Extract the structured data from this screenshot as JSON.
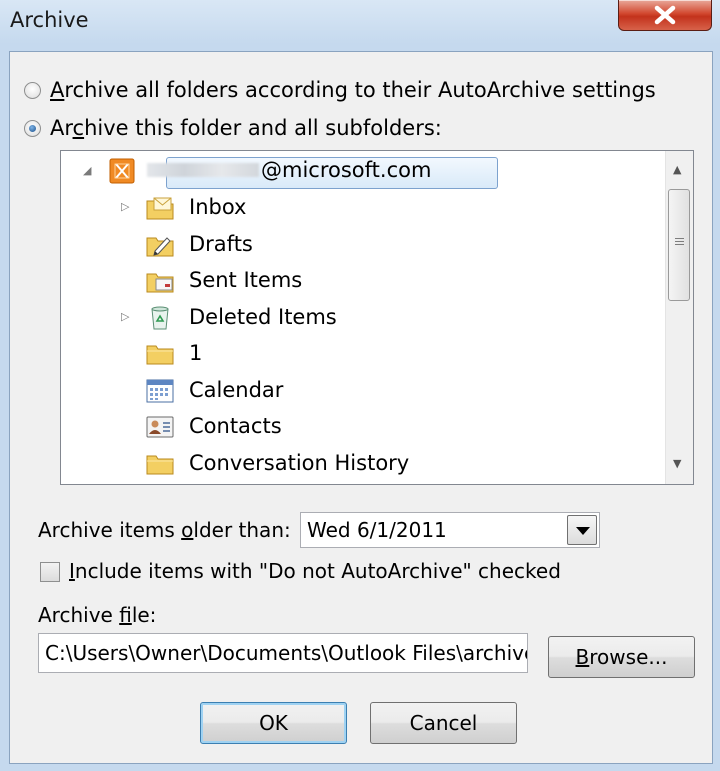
{
  "window": {
    "title": "Archive"
  },
  "options": {
    "archive_all_label": "Archive all folders according to their AutoArchive settings",
    "archive_all_mnemonic": "A",
    "archive_this_label_pre": "Ar",
    "archive_this_mnemonic": "c",
    "archive_this_label_post": "hive this folder and all subfolders:"
  },
  "tree": {
    "account_domain": "@microsoft.com",
    "folders": [
      {
        "label": "Inbox",
        "icon": "inbox-folder-icon",
        "expandable": true
      },
      {
        "label": "Drafts",
        "icon": "drafts-folder-icon",
        "expandable": false
      },
      {
        "label": "Sent Items",
        "icon": "sent-items-folder-icon",
        "expandable": false
      },
      {
        "label": "Deleted Items",
        "icon": "recycle-bin-icon",
        "expandable": true
      },
      {
        "label": "1",
        "icon": "folder-icon",
        "expandable": false
      },
      {
        "label": "Calendar",
        "icon": "calendar-icon",
        "expandable": false
      },
      {
        "label": "Contacts",
        "icon": "contacts-card-icon",
        "expandable": false
      },
      {
        "label": "Conversation History",
        "icon": "folder-icon",
        "expandable": false
      }
    ]
  },
  "older_than": {
    "label_pre": "Archive items ",
    "label_mnemonic": "o",
    "label_post": "lder than:",
    "value": "Wed 6/1/2011"
  },
  "include_items": {
    "label_mnemonic": "I",
    "label_rest": "nclude items with \"Do not AutoArchive\" checked",
    "checked": false
  },
  "archive_file": {
    "label_pre": "Archive ",
    "label_mnemonic": "f",
    "label_post": "ile:",
    "value": "C:\\Users\\Owner\\Documents\\Outlook Files\\archive"
  },
  "buttons": {
    "browse_mnemonic": "B",
    "browse_rest": "rowse...",
    "ok": "OK",
    "cancel": "Cancel"
  },
  "colors": {
    "selection_border": "#7da2ce",
    "close_button": "#c3321c"
  }
}
